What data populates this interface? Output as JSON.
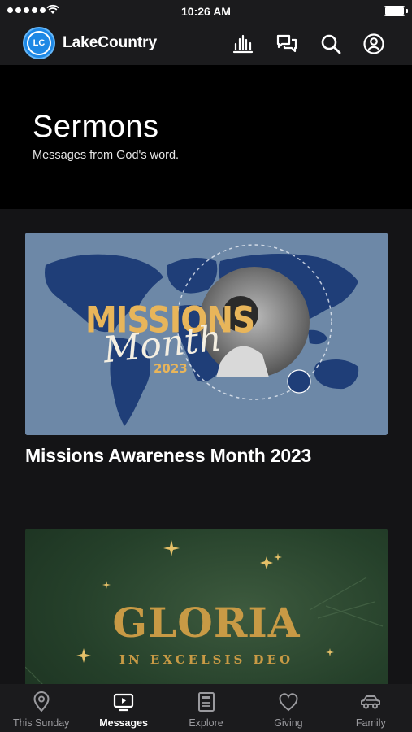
{
  "status_bar": {
    "time": "10:26 AM"
  },
  "header": {
    "logo_text": "LC",
    "app_name": "LakeCountry",
    "icons": [
      "live-audio-icon",
      "chat-icon",
      "search-icon",
      "account-icon"
    ]
  },
  "hero": {
    "title": "Sermons",
    "subtitle": "Messages from God's word."
  },
  "cards": [
    {
      "title": "Missions Awareness Month 2023",
      "art": {
        "word1": "MISSIONS",
        "word2": "Month",
        "year": "2023"
      }
    },
    {
      "title": "",
      "art": {
        "word1": "GLORIA",
        "word2": "IN EXCELSIS DEO"
      }
    }
  ],
  "tabs": [
    {
      "label": "This Sunday",
      "icon": "location-pin-icon",
      "active": false
    },
    {
      "label": "Messages",
      "icon": "tv-play-icon",
      "active": true
    },
    {
      "label": "Explore",
      "icon": "news-icon",
      "active": false
    },
    {
      "label": "Giving",
      "icon": "heart-icon",
      "active": false
    },
    {
      "label": "Family",
      "icon": "car-icon",
      "active": false
    }
  ],
  "colors": {
    "accent": "#1e88e5",
    "header_bg": "#1b1b1d",
    "content_bg": "#141416",
    "gold": "#e8b55a"
  }
}
